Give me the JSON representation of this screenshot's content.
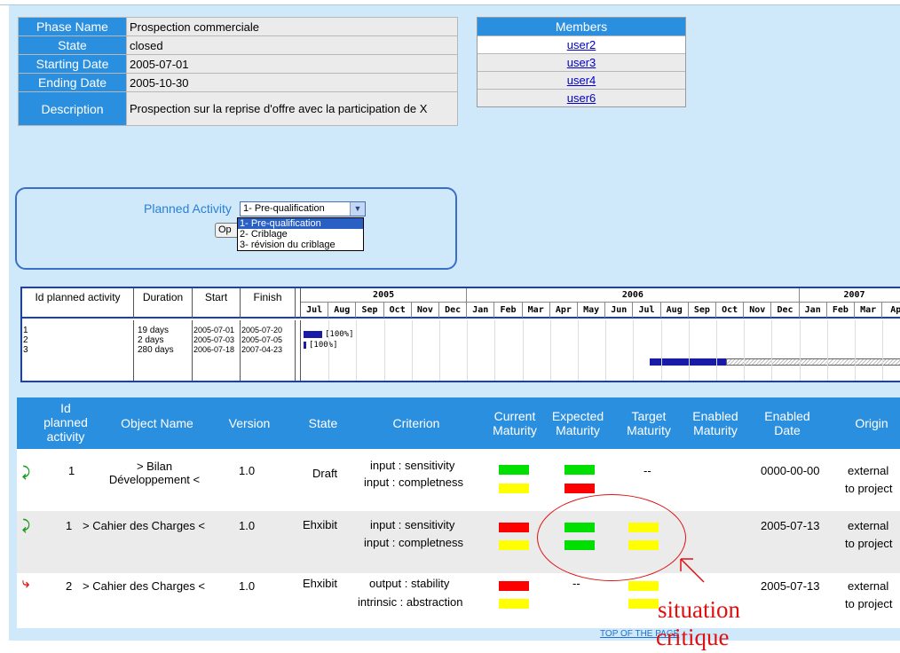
{
  "phase": {
    "rows": [
      {
        "label": "Phase Name",
        "value": "Prospection commerciale"
      },
      {
        "label": "State",
        "value": "closed"
      },
      {
        "label": "Starting Date",
        "value": "2005-07-01"
      },
      {
        "label": "Ending Date",
        "value": "2005-10-30"
      },
      {
        "label": "Description",
        "value": "Prospection sur la reprise d'offre avec la participation de X"
      }
    ]
  },
  "members": {
    "title": "Members",
    "users": [
      "user2",
      "user3",
      "user4",
      "user6"
    ]
  },
  "planned_activity": {
    "label": "Planned Activity",
    "selected": "1- Pre-qualification",
    "button_label": "Op",
    "options": [
      "1- Pre-qualification",
      "2- Criblage",
      "3- révision du criblage"
    ]
  },
  "gantt": {
    "headers": [
      "Id planned activity",
      "Duration",
      "Start",
      "Finish"
    ],
    "years": [
      "2005",
      "2006",
      "2007"
    ],
    "months": [
      "Jul",
      "Aug",
      "Sep",
      "Oct",
      "Nov",
      "Dec",
      "Jan",
      "Feb",
      "Mar",
      "Apr",
      "May",
      "Jun",
      "Jul",
      "Aug",
      "Sep",
      "Oct",
      "Nov",
      "Dec",
      "Jan",
      "Feb",
      "Mar",
      "Ap"
    ],
    "ids": [
      "1",
      "2",
      "3"
    ],
    "durations": [
      "19 days",
      "2 days",
      "280 days"
    ],
    "starts": [
      "2005-07-01",
      "2005-07-03",
      "2006-07-18"
    ],
    "finishes": [
      "2005-07-20",
      "2005-07-05",
      "2007-04-23"
    ],
    "percent_labels": [
      "[100%]",
      "[100%]"
    ]
  },
  "objects": {
    "headers": {
      "id": "Id planned activity",
      "name": "Object Name",
      "version": "Version",
      "state": "State",
      "criterion": "Criterion",
      "current": "Current Maturity",
      "expected": "Expected Maturity",
      "target": "Target Maturity",
      "enabled": "Enabled Maturity",
      "date": "Enabled Date",
      "origin": "Origin"
    },
    "rows": [
      {
        "id": "1",
        "name": "> Bilan Développement <",
        "version": "1.0",
        "state": "Draft",
        "criteria": [
          "input : sensitivity",
          "input : completness"
        ],
        "target_text": "--",
        "expected_text": "",
        "date": "0000-00-00",
        "origin": [
          "external",
          "to project"
        ],
        "arrow_color": "#1a9a1a"
      },
      {
        "id": "1",
        "name": "> Cahier des Charges <",
        "version": "1.0",
        "state": "Ehxibit",
        "criteria": [
          "input : sensitivity",
          "input : completness"
        ],
        "target_text": "",
        "expected_text": "",
        "date": "2005-07-13",
        "origin": [
          "external",
          "to project"
        ],
        "arrow_color": "#1a9a1a"
      },
      {
        "id": "2",
        "name": "> Cahier des Charges <",
        "version": "1.0",
        "state": "Ehxibit",
        "criteria": [
          "output : stability",
          "intrinsic : abstraction"
        ],
        "target_text": "",
        "expected_text": "--",
        "date": "2005-07-13",
        "origin": [
          "external",
          "to project"
        ],
        "arrow_color": "#e02020"
      }
    ],
    "colors": {
      "green": "#00e000",
      "yellow": "#ffff00",
      "red": "#ff0000"
    }
  },
  "footer": {
    "top_link": "TOP OF THE PAGE"
  },
  "annotation": {
    "line1": "situation",
    "line2": "critique"
  }
}
